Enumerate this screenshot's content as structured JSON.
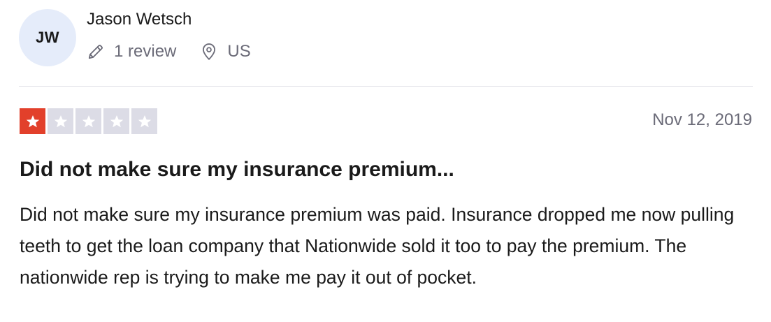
{
  "reviewer": {
    "initials": "JW",
    "name": "Jason Wetsch",
    "review_count": "1 review",
    "location": "US",
    "avatar_color": "#e5ecfa"
  },
  "review": {
    "rating": 1,
    "rating_max": 5,
    "rating_color": "#e2402b",
    "date": "Nov 12, 2019",
    "title": "Did not make sure my insurance premium...",
    "body": "Did not make sure my insurance premium was paid. Insurance dropped me now pulling teeth to get the loan company that Nationwide sold it too to pay the premium. The nationwide rep is trying to make me pay it out of pocket."
  },
  "icons": {
    "review_count": "pencil-icon",
    "location": "map-pin-icon",
    "star": "star-icon"
  }
}
